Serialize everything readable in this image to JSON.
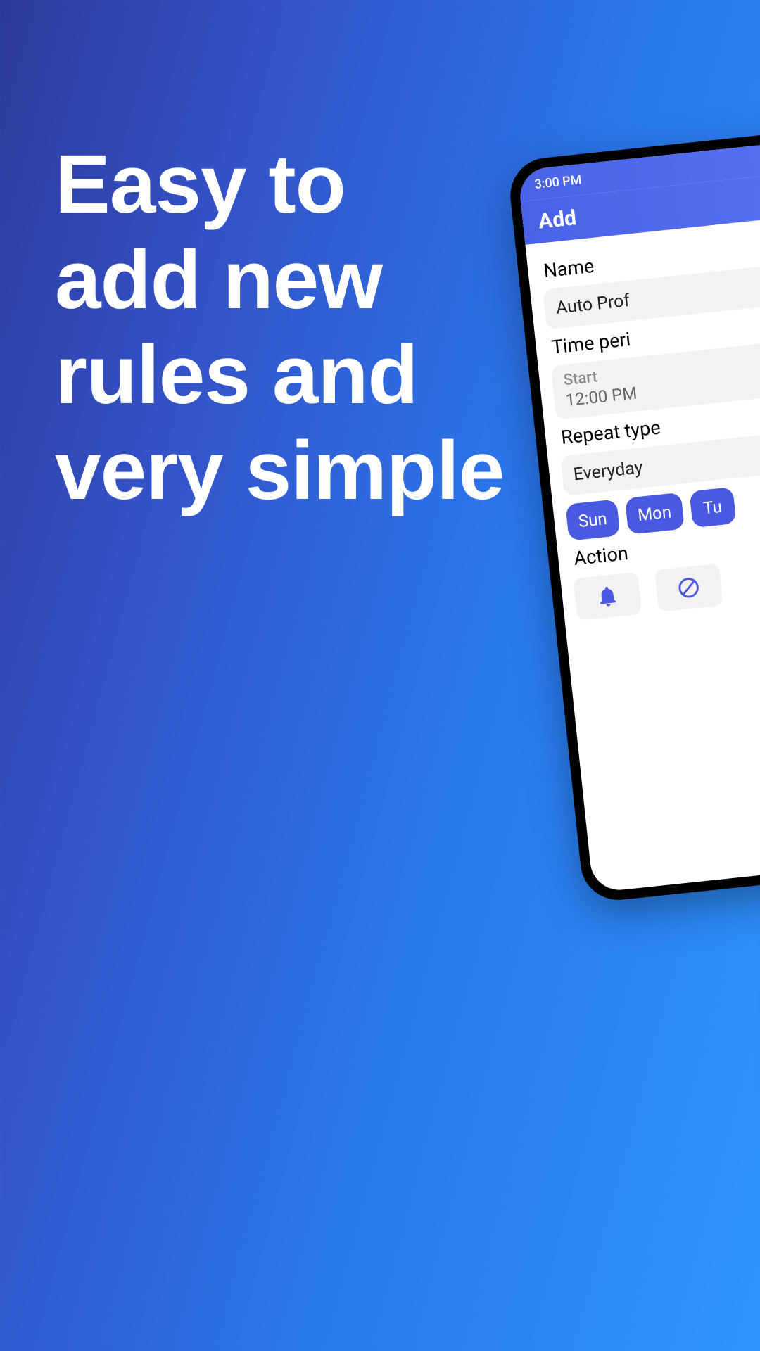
{
  "headline": {
    "line1": "Easy to",
    "line2": "add new",
    "line3": "rules and",
    "line4": "very simple"
  },
  "statusbar": {
    "time": "3:00 PM"
  },
  "appbar": {
    "title": "Add"
  },
  "form": {
    "name_label": "Name",
    "name_value": "Auto Prof",
    "time_label": "Time peri",
    "start_label": "Start",
    "start_value": "12:00 PM",
    "repeat_label": "Repeat type",
    "repeat_value": "Everyday",
    "days": [
      "Sun",
      "Mon",
      "Tu"
    ],
    "action_label": "Action"
  }
}
